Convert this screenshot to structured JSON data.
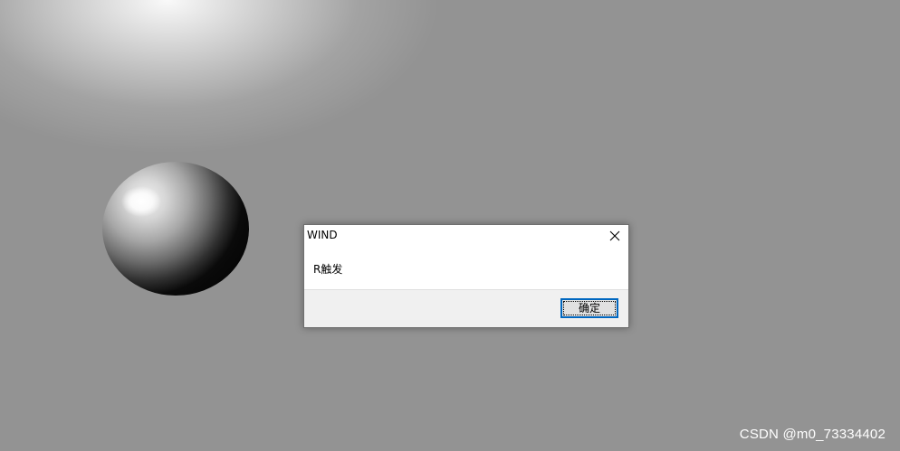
{
  "dialog": {
    "title": "WIND",
    "message": "R触发",
    "ok_label": "确定",
    "close_icon": "close-icon"
  },
  "scene": {
    "object": "sphere",
    "background_color": "#939393"
  },
  "watermark": {
    "text": "CSDN @m0_73334402"
  },
  "colors": {
    "accent": "#0067c0",
    "dialog_footer": "#f0f0f0"
  }
}
